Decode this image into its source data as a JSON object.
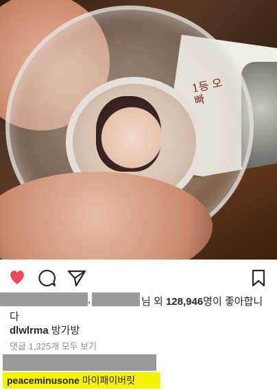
{
  "post": {
    "likes": {
      "comma": ",",
      "suffix_word": "님 외 ",
      "count": "128,946",
      "text_after_count": "명이 좋아합니",
      "wrap": "다"
    },
    "caption": {
      "username": "dlwlrma",
      "text": "방가방"
    },
    "view_comments": "댓글 1,325개 모두 보기",
    "highlighted_comment": {
      "username": "peaceminusone",
      "text": "마이패이버릿"
    },
    "photo_writing": "1등 오빠"
  },
  "colors": {
    "heart": "#ed4956",
    "highlight": "#f6f200",
    "redaction": "#9a9a9a",
    "muted": "#8e8e8e"
  },
  "icons": [
    "heart-icon",
    "comment-icon",
    "share-icon",
    "bookmark-icon"
  ]
}
